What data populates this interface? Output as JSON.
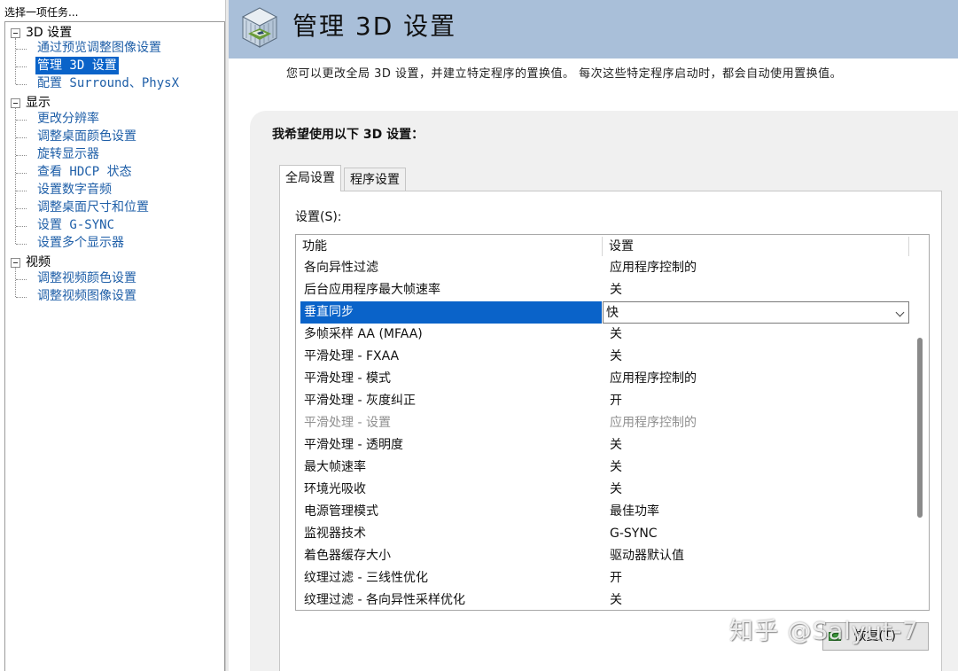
{
  "left_pane": {
    "header": "选择一项任务...",
    "groups": [
      {
        "label": "3D 设置",
        "items": [
          "通过预览调整图像设置",
          "管理 3D 设置",
          "配置 Surround、PhysX"
        ]
      },
      {
        "label": "显示",
        "items": [
          "更改分辨率",
          "调整桌面颜色设置",
          "旋转显示器",
          "查看 HDCP 状态",
          "设置数字音频",
          "调整桌面尺寸和位置",
          "设置 G-SYNC",
          "设置多个显示器"
        ]
      },
      {
        "label": "视频",
        "items": [
          "调整视频颜色设置",
          "调整视频图像设置"
        ]
      }
    ],
    "selected_item": "管理 3D 设置"
  },
  "header": {
    "title": "管理 3D 设置",
    "icon": "nvidia-3d-settings-icon",
    "band_color": "#a9bfd9"
  },
  "description": "您可以更改全局 3D 设置，并建立特定程序的置换值。 每次这些特定程序启动时，都会自动使用置换值。",
  "panel": {
    "heading": "我希望使用以下 3D 设置：",
    "tabs": [
      {
        "label": "全局设置",
        "active": true
      },
      {
        "label": "程序设置",
        "active": false
      }
    ],
    "settings_label": "设置(S):",
    "columns": [
      "功能",
      "设置"
    ],
    "rows": [
      {
        "feature": "各向异性过滤",
        "value": "应用程序控制的",
        "state": "normal"
      },
      {
        "feature": "后台应用程序最大帧速率",
        "value": "关",
        "state": "normal"
      },
      {
        "feature": "垂直同步",
        "value": "快",
        "state": "selected"
      },
      {
        "feature": "多帧采样 AA (MFAA)",
        "value": "关",
        "state": "normal"
      },
      {
        "feature": "平滑处理 - FXAA",
        "value": "关",
        "state": "normal"
      },
      {
        "feature": "平滑处理 - 模式",
        "value": "应用程序控制的",
        "state": "normal"
      },
      {
        "feature": "平滑处理 - 灰度纠正",
        "value": "开",
        "state": "normal"
      },
      {
        "feature": "平滑处理 - 设置",
        "value": "应用程序控制的",
        "state": "disabled"
      },
      {
        "feature": "平滑处理 - 透明度",
        "value": "关",
        "state": "normal"
      },
      {
        "feature": "最大帧速率",
        "value": "关",
        "state": "normal"
      },
      {
        "feature": "环境光吸收",
        "value": "关",
        "state": "normal"
      },
      {
        "feature": "电源管理模式",
        "value": "最佳功率",
        "state": "normal"
      },
      {
        "feature": "监视器技术",
        "value": "G-SYNC",
        "state": "normal"
      },
      {
        "feature": "着色器缓存大小",
        "value": "驱动器默认值",
        "state": "normal"
      },
      {
        "feature": "纹理过滤 - 三线性优化",
        "value": "开",
        "state": "normal"
      },
      {
        "feature": "纹理过滤 - 各向异性采样优化",
        "value": "关",
        "state": "normal"
      }
    ],
    "restore_label": "恢复(T)"
  },
  "watermark": "知乎 @Salyut-7",
  "colors": {
    "selection": "#0a63c9",
    "link": "#1f5fa8",
    "panel_bg": "#f0f0f0"
  }
}
